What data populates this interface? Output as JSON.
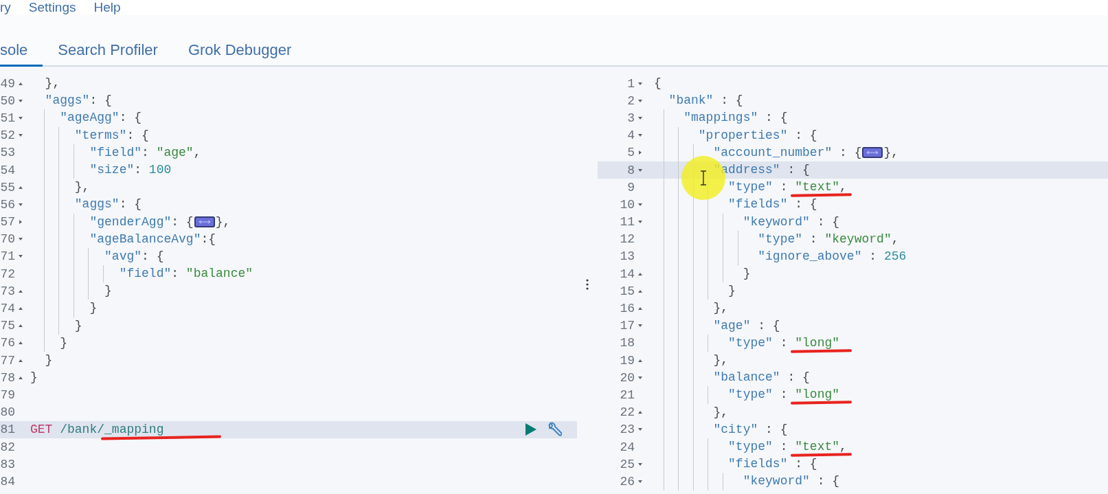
{
  "menu": [
    "ry",
    "Settings",
    "Help"
  ],
  "tabs": [
    {
      "label": "sole",
      "selected": true
    },
    {
      "label": "Search Profiler",
      "selected": false
    },
    {
      "label": "Grok Debugger",
      "selected": false
    }
  ],
  "request_editor": {
    "lines": [
      {
        "num": "49",
        "kind": "end",
        "tokens": [
          {
            "t": "  },",
            "kind": "punct"
          }
        ]
      },
      {
        "num": "50",
        "kind": "open",
        "tokens": [
          {
            "t": "  \"aggs\"",
            "kind": "key"
          },
          {
            "t": ": {",
            "kind": "punct"
          }
        ]
      },
      {
        "num": "51",
        "kind": "open",
        "tokens": [
          {
            "t": "    \"ageAgg\"",
            "kind": "key"
          },
          {
            "t": ": {",
            "kind": "punct"
          }
        ]
      },
      {
        "num": "52",
        "kind": "open",
        "tokens": [
          {
            "t": "      \"terms\"",
            "kind": "key"
          },
          {
            "t": ": {",
            "kind": "punct"
          }
        ]
      },
      {
        "num": "53",
        "kind": "plain",
        "tokens": [
          {
            "t": "        \"field\"",
            "kind": "key"
          },
          {
            "t": ": ",
            "kind": "punct"
          },
          {
            "t": "\"age\"",
            "kind": "str"
          },
          {
            "t": ",",
            "kind": "punct"
          }
        ]
      },
      {
        "num": "54",
        "kind": "plain",
        "tokens": [
          {
            "t": "        \"size\"",
            "kind": "key"
          },
          {
            "t": ": ",
            "kind": "punct"
          },
          {
            "t": "100",
            "kind": "num"
          }
        ]
      },
      {
        "num": "55",
        "kind": "end",
        "tokens": [
          {
            "t": "      },",
            "kind": "punct"
          }
        ]
      },
      {
        "num": "56",
        "kind": "open",
        "tokens": [
          {
            "t": "      \"aggs\"",
            "kind": "key"
          },
          {
            "t": ": {",
            "kind": "punct"
          }
        ]
      },
      {
        "num": "57",
        "kind": "closed",
        "tokens": [
          {
            "t": "        \"genderAgg\"",
            "kind": "key"
          },
          {
            "t": ": {",
            "kind": "punct"
          },
          {
            "kind": "collapsed"
          },
          {
            "t": "},",
            "kind": "punct"
          }
        ]
      },
      {
        "num": "70",
        "kind": "open",
        "tokens": [
          {
            "t": "        \"ageBalanceAvg\"",
            "kind": "key"
          },
          {
            "t": ":{",
            "kind": "punct"
          }
        ]
      },
      {
        "num": "71",
        "kind": "open",
        "tokens": [
          {
            "t": "          \"avg\"",
            "kind": "key"
          },
          {
            "t": ": {",
            "kind": "punct"
          }
        ]
      },
      {
        "num": "72",
        "kind": "plain",
        "tokens": [
          {
            "t": "            \"field\"",
            "kind": "key"
          },
          {
            "t": ": ",
            "kind": "punct"
          },
          {
            "t": "\"balance\"",
            "kind": "str"
          }
        ]
      },
      {
        "num": "73",
        "kind": "end",
        "tokens": [
          {
            "t": "          }",
            "kind": "punct"
          }
        ]
      },
      {
        "num": "74",
        "kind": "end",
        "tokens": [
          {
            "t": "        }",
            "kind": "punct"
          }
        ]
      },
      {
        "num": "75",
        "kind": "end",
        "tokens": [
          {
            "t": "      }",
            "kind": "punct"
          }
        ]
      },
      {
        "num": "76",
        "kind": "end",
        "tokens": [
          {
            "t": "    }",
            "kind": "punct"
          }
        ]
      },
      {
        "num": "77",
        "kind": "end",
        "tokens": [
          {
            "t": "  }",
            "kind": "punct"
          }
        ]
      },
      {
        "num": "78",
        "kind": "end",
        "tokens": [
          {
            "t": "}",
            "kind": "punct"
          }
        ]
      },
      {
        "num": "79",
        "kind": "plain"
      },
      {
        "num": "80",
        "kind": "plain"
      },
      {
        "num": "81",
        "kind": "plain",
        "selected": true,
        "underlined": true,
        "tokens": [
          {
            "t": "GET",
            "kind": "method"
          },
          {
            "t": " /bank/_mapping",
            "kind": "path"
          }
        ]
      },
      {
        "num": "82",
        "kind": "plain"
      },
      {
        "num": "83",
        "kind": "plain"
      },
      {
        "num": "84",
        "kind": "plain"
      }
    ]
  },
  "response_editor": {
    "lines": [
      {
        "num": "1",
        "kind": "open",
        "tokens": [
          {
            "t": "{",
            "kind": "punct"
          }
        ]
      },
      {
        "num": "2",
        "kind": "open",
        "tokens": [
          {
            "t": "  \"bank\"",
            "kind": "key"
          },
          {
            "t": " : {",
            "kind": "punct"
          }
        ]
      },
      {
        "num": "3",
        "kind": "open",
        "tokens": [
          {
            "t": "    \"mappings\"",
            "kind": "key"
          },
          {
            "t": " : {",
            "kind": "punct"
          }
        ]
      },
      {
        "num": "4",
        "kind": "open",
        "tokens": [
          {
            "t": "      \"properties\"",
            "kind": "key"
          },
          {
            "t": " : {",
            "kind": "punct"
          }
        ]
      },
      {
        "num": "5",
        "kind": "closed",
        "tokens": [
          {
            "t": "        \"account_number\"",
            "kind": "key"
          },
          {
            "t": " : {",
            "kind": "punct"
          },
          {
            "kind": "collapsed"
          },
          {
            "t": "},",
            "kind": "punct"
          }
        ]
      },
      {
        "num": "8",
        "kind": "open",
        "selected": true,
        "tokens": [
          {
            "t": "        \"address\"",
            "kind": "key"
          },
          {
            "t": " : {",
            "kind": "punct"
          }
        ]
      },
      {
        "num": "9",
        "kind": "plain",
        "underlined": true,
        "tokens": [
          {
            "t": "          \"type\"",
            "kind": "key"
          },
          {
            "t": " : ",
            "kind": "punct"
          },
          {
            "t": "\"text\"",
            "kind": "str"
          },
          {
            "t": ",",
            "kind": "punct"
          }
        ]
      },
      {
        "num": "10",
        "kind": "open",
        "tokens": [
          {
            "t": "          \"fields\"",
            "kind": "key"
          },
          {
            "t": " : {",
            "kind": "punct"
          }
        ]
      },
      {
        "num": "11",
        "kind": "open",
        "tokens": [
          {
            "t": "            \"keyword\"",
            "kind": "key"
          },
          {
            "t": " : {",
            "kind": "punct"
          }
        ]
      },
      {
        "num": "12",
        "kind": "plain",
        "tokens": [
          {
            "t": "              \"type\"",
            "kind": "key"
          },
          {
            "t": " : ",
            "kind": "punct"
          },
          {
            "t": "\"keyword\"",
            "kind": "str"
          },
          {
            "t": ",",
            "kind": "punct"
          }
        ]
      },
      {
        "num": "13",
        "kind": "plain",
        "tokens": [
          {
            "t": "              \"ignore_above\"",
            "kind": "key"
          },
          {
            "t": " : ",
            "kind": "punct"
          },
          {
            "t": "256",
            "kind": "num"
          }
        ]
      },
      {
        "num": "14",
        "kind": "end",
        "tokens": [
          {
            "t": "            }",
            "kind": "punct"
          }
        ]
      },
      {
        "num": "15",
        "kind": "end",
        "tokens": [
          {
            "t": "          }",
            "kind": "punct"
          }
        ]
      },
      {
        "num": "16",
        "kind": "end",
        "tokens": [
          {
            "t": "        },",
            "kind": "punct"
          }
        ]
      },
      {
        "num": "17",
        "kind": "open",
        "tokens": [
          {
            "t": "        \"age\"",
            "kind": "key"
          },
          {
            "t": " : {",
            "kind": "punct"
          }
        ]
      },
      {
        "num": "18",
        "kind": "plain",
        "underlined": true,
        "tokens": [
          {
            "t": "          \"type\"",
            "kind": "key"
          },
          {
            "t": " : ",
            "kind": "punct"
          },
          {
            "t": "\"long\"",
            "kind": "str"
          }
        ]
      },
      {
        "num": "19",
        "kind": "end",
        "tokens": [
          {
            "t": "        },",
            "kind": "punct"
          }
        ]
      },
      {
        "num": "20",
        "kind": "open",
        "tokens": [
          {
            "t": "        \"balance\"",
            "kind": "key"
          },
          {
            "t": " : {",
            "kind": "punct"
          }
        ]
      },
      {
        "num": "21",
        "kind": "plain",
        "underlined": true,
        "tokens": [
          {
            "t": "          \"type\"",
            "kind": "key"
          },
          {
            "t": " : ",
            "kind": "punct"
          },
          {
            "t": "\"long\"",
            "kind": "str"
          }
        ]
      },
      {
        "num": "22",
        "kind": "end",
        "tokens": [
          {
            "t": "        },",
            "kind": "punct"
          }
        ]
      },
      {
        "num": "23",
        "kind": "open",
        "tokens": [
          {
            "t": "        \"city\"",
            "kind": "key"
          },
          {
            "t": " : {",
            "kind": "punct"
          }
        ]
      },
      {
        "num": "24",
        "kind": "plain",
        "underlined": true,
        "tokens": [
          {
            "t": "          \"type\"",
            "kind": "key"
          },
          {
            "t": " : ",
            "kind": "punct"
          },
          {
            "t": "\"text\"",
            "kind": "str"
          },
          {
            "t": ",",
            "kind": "punct"
          }
        ]
      },
      {
        "num": "25",
        "kind": "open",
        "tokens": [
          {
            "t": "          \"fields\"",
            "kind": "key"
          },
          {
            "t": " : {",
            "kind": "punct"
          }
        ]
      },
      {
        "num": "26",
        "kind": "open",
        "tokens": [
          {
            "t": "            \"keyword\"",
            "kind": "key"
          },
          {
            "t": " : {",
            "kind": "punct"
          }
        ]
      }
    ]
  }
}
